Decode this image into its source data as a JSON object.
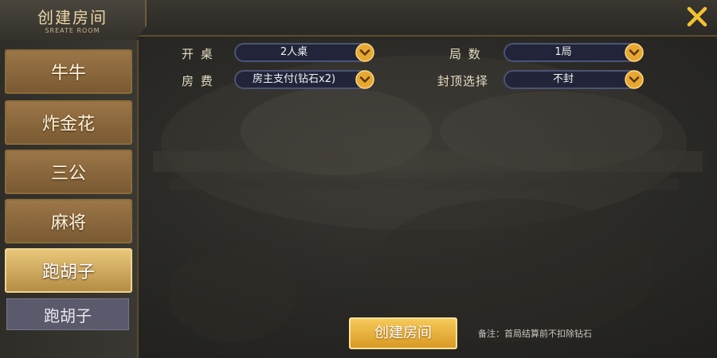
{
  "header": {
    "title": "创建房间",
    "subtitle": "SREATE ROOM"
  },
  "sidebar": {
    "tabs": [
      {
        "label": "牛牛"
      },
      {
        "label": "炸金花"
      },
      {
        "label": "三公"
      },
      {
        "label": "麻将"
      },
      {
        "label": "跑胡子"
      }
    ],
    "active_tab": "跑胡子",
    "subtab": {
      "label": "跑胡子"
    }
  },
  "form": {
    "table": {
      "label": "开 桌",
      "value": "2人桌"
    },
    "fee": {
      "label": "房 费",
      "value": "房主支付(钻石x2)"
    },
    "rounds": {
      "label": "局 数",
      "value": "1局"
    },
    "cap": {
      "label": "封顶选择",
      "value": "不封"
    }
  },
  "footer": {
    "create_button": "创建房间",
    "note": "备注：首局结算前不扣除钻石"
  },
  "icons": {
    "close": "close-icon",
    "dropdown": "chevron-down-icon"
  },
  "colors": {
    "accent_gold": "#f5c95a",
    "tab_brown": "#9b7647",
    "subtab_purple": "#5b5a6c",
    "close_yellow": "#f2c230"
  }
}
